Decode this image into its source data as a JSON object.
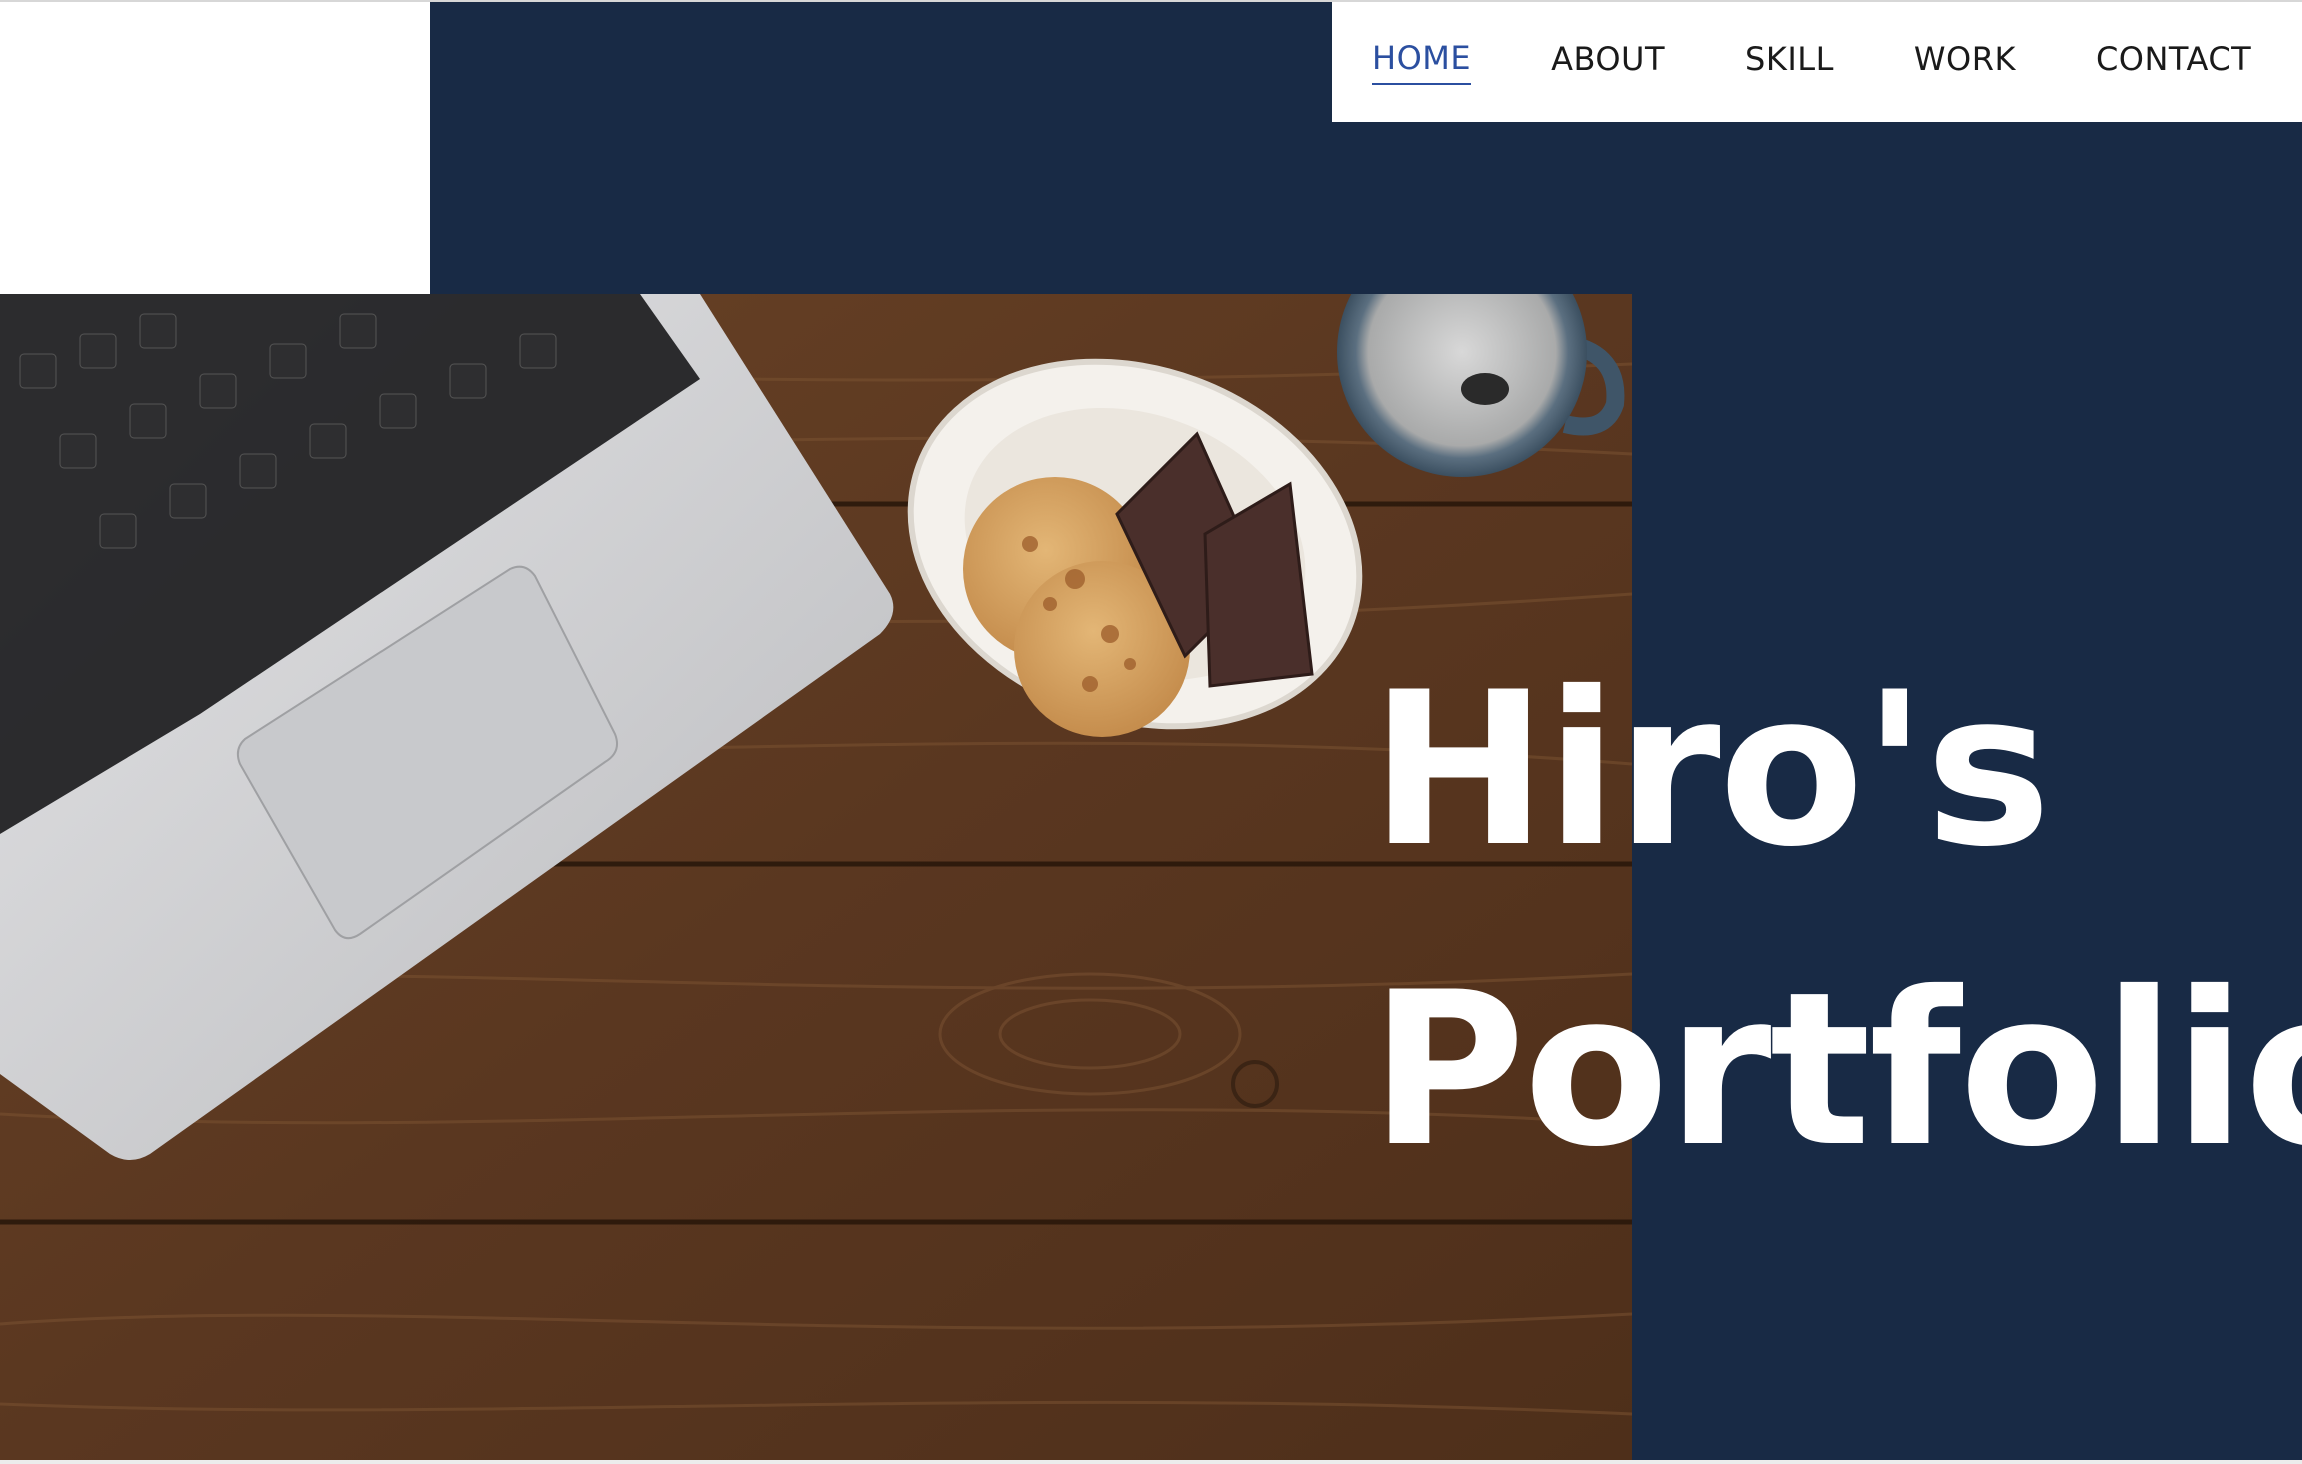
{
  "navigation": {
    "items": [
      {
        "label": "HOME",
        "active": true
      },
      {
        "label": "ABOUT",
        "active": false
      },
      {
        "label": "SKILL",
        "active": false
      },
      {
        "label": "WORK",
        "active": false
      },
      {
        "label": "CONTACT",
        "active": false
      }
    ]
  },
  "hero": {
    "title_line_1": "Hiro's",
    "title_line_2": "Portfolio",
    "image": "desk-with-laptop-cookies-chocolate-coffee"
  },
  "colors": {
    "navy_background": "#182a45",
    "nav_background": "#ffffff",
    "nav_active": "#2b4fa0",
    "nav_text": "#1a1a1a",
    "hero_text": "#ffffff",
    "wood": "#5e3a20"
  }
}
